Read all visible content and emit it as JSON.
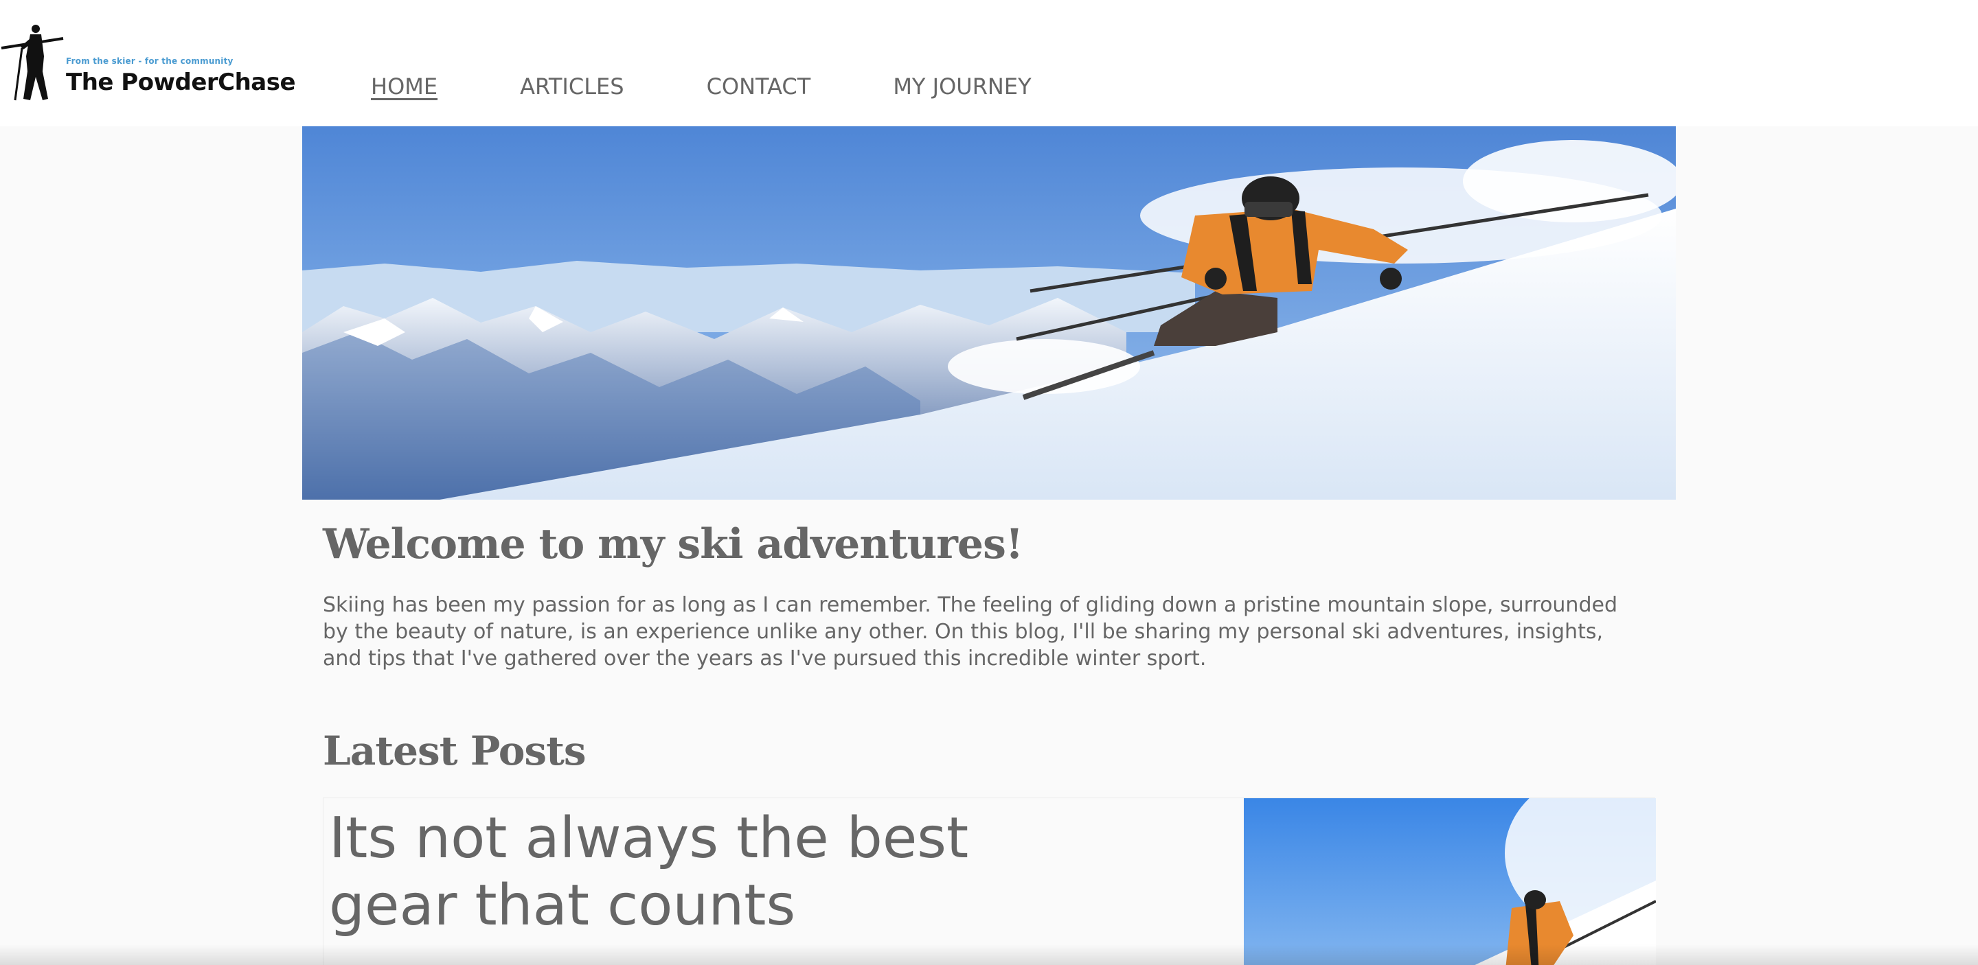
{
  "header": {
    "logo": {
      "tagline": "From the skier - for the community",
      "title": "The PowderChase"
    },
    "nav": [
      {
        "label": "HOME",
        "active": true
      },
      {
        "label": "ARTICLES",
        "active": false
      },
      {
        "label": "CONTACT",
        "active": false
      },
      {
        "label": "MY JOURNEY",
        "active": false
      }
    ]
  },
  "hero": {
    "image_subject": "skier in orange jacket descending snowy mountain slope"
  },
  "intro": {
    "heading": "Welcome to my ski adventures!",
    "paragraph": "Skiing has been my passion for as long as I can remember. The feeling of gliding down a pristine mountain slope, surrounded by the beauty of nature, is an experience unlike any other. On this blog, I'll be sharing my personal ski adventures, insights, and tips that I've gathered over the years as I've pursued this incredible winter sport."
  },
  "latest": {
    "heading": "Latest Posts",
    "posts": [
      {
        "title_line1": "Its not always the best",
        "title_line2": "gear that counts",
        "image_subject": "skier in orange jacket"
      }
    ]
  },
  "colors": {
    "text": "#666666",
    "background": "#fafafa",
    "header_bg": "#ffffff",
    "sky": "#5b95dc",
    "jacket": "#e8892f"
  }
}
